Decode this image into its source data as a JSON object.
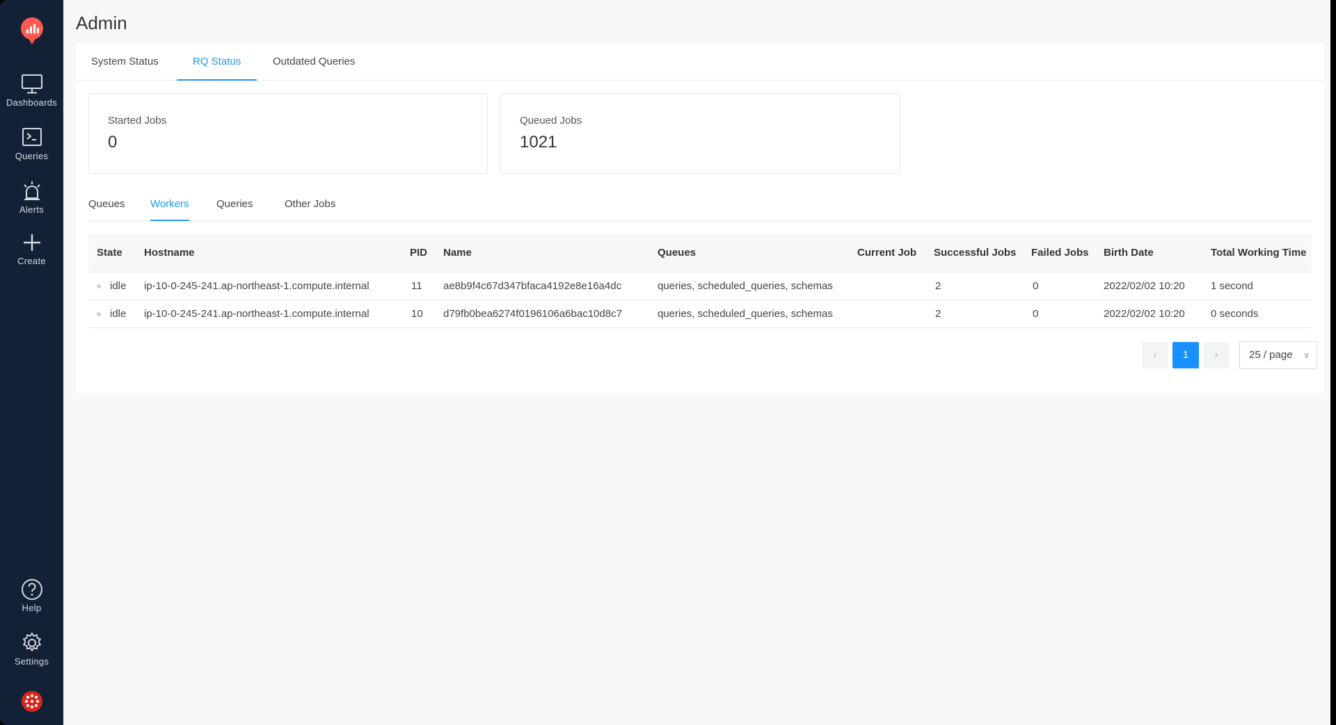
{
  "sidebar": {
    "items": [
      {
        "label": "Dashboards",
        "icon": "monitor-icon"
      },
      {
        "label": "Queries",
        "icon": "terminal-icon"
      },
      {
        "label": "Alerts",
        "icon": "siren-icon"
      },
      {
        "label": "Create",
        "icon": "plus-icon"
      }
    ],
    "bottom": [
      {
        "label": "Help",
        "icon": "help-icon"
      },
      {
        "label": "Settings",
        "icon": "gear-icon"
      }
    ]
  },
  "page": {
    "title": "Admin"
  },
  "tabs": [
    {
      "label": "System Status"
    },
    {
      "label": "RQ Status"
    },
    {
      "label": "Outdated Queries"
    }
  ],
  "stats": {
    "started": {
      "label": "Started Jobs",
      "value": "0"
    },
    "queued": {
      "label": "Queued Jobs",
      "value": "1021"
    }
  },
  "subtabs": [
    {
      "label": "Queues"
    },
    {
      "label": "Workers"
    },
    {
      "label": "Queries"
    },
    {
      "label": "Other Jobs"
    }
  ],
  "table": {
    "columns": [
      "State",
      "Hostname",
      "PID",
      "Name",
      "Queues",
      "Current Job",
      "Successful Jobs",
      "Failed Jobs",
      "Birth Date",
      "Total Working Time"
    ],
    "rows": [
      [
        "idle",
        "ip-10-0-245-241.ap-northeast-1.compute.internal",
        "11",
        "ae8b9f4c67d347bfaca4192e8e16a4dc",
        "queries, scheduled_queries, schemas",
        "",
        "2",
        "0",
        "2022/02/02 10:20",
        "1 second"
      ],
      [
        "idle",
        "ip-10-0-245-241.ap-northeast-1.compute.internal",
        "10",
        "d79fb0bea6274f0196106a6bac10d8c7",
        "queries, scheduled_queries, schemas",
        "",
        "2",
        "0",
        "2022/02/02 10:20",
        "0 seconds"
      ]
    ]
  },
  "pagination": {
    "prev": "‹",
    "page": "1",
    "next": "›",
    "page_size": "25 / page"
  },
  "colors": {
    "sidebar_bg": "#132137",
    "accent": "#1890ff",
    "logo": "#ff5a4f"
  }
}
